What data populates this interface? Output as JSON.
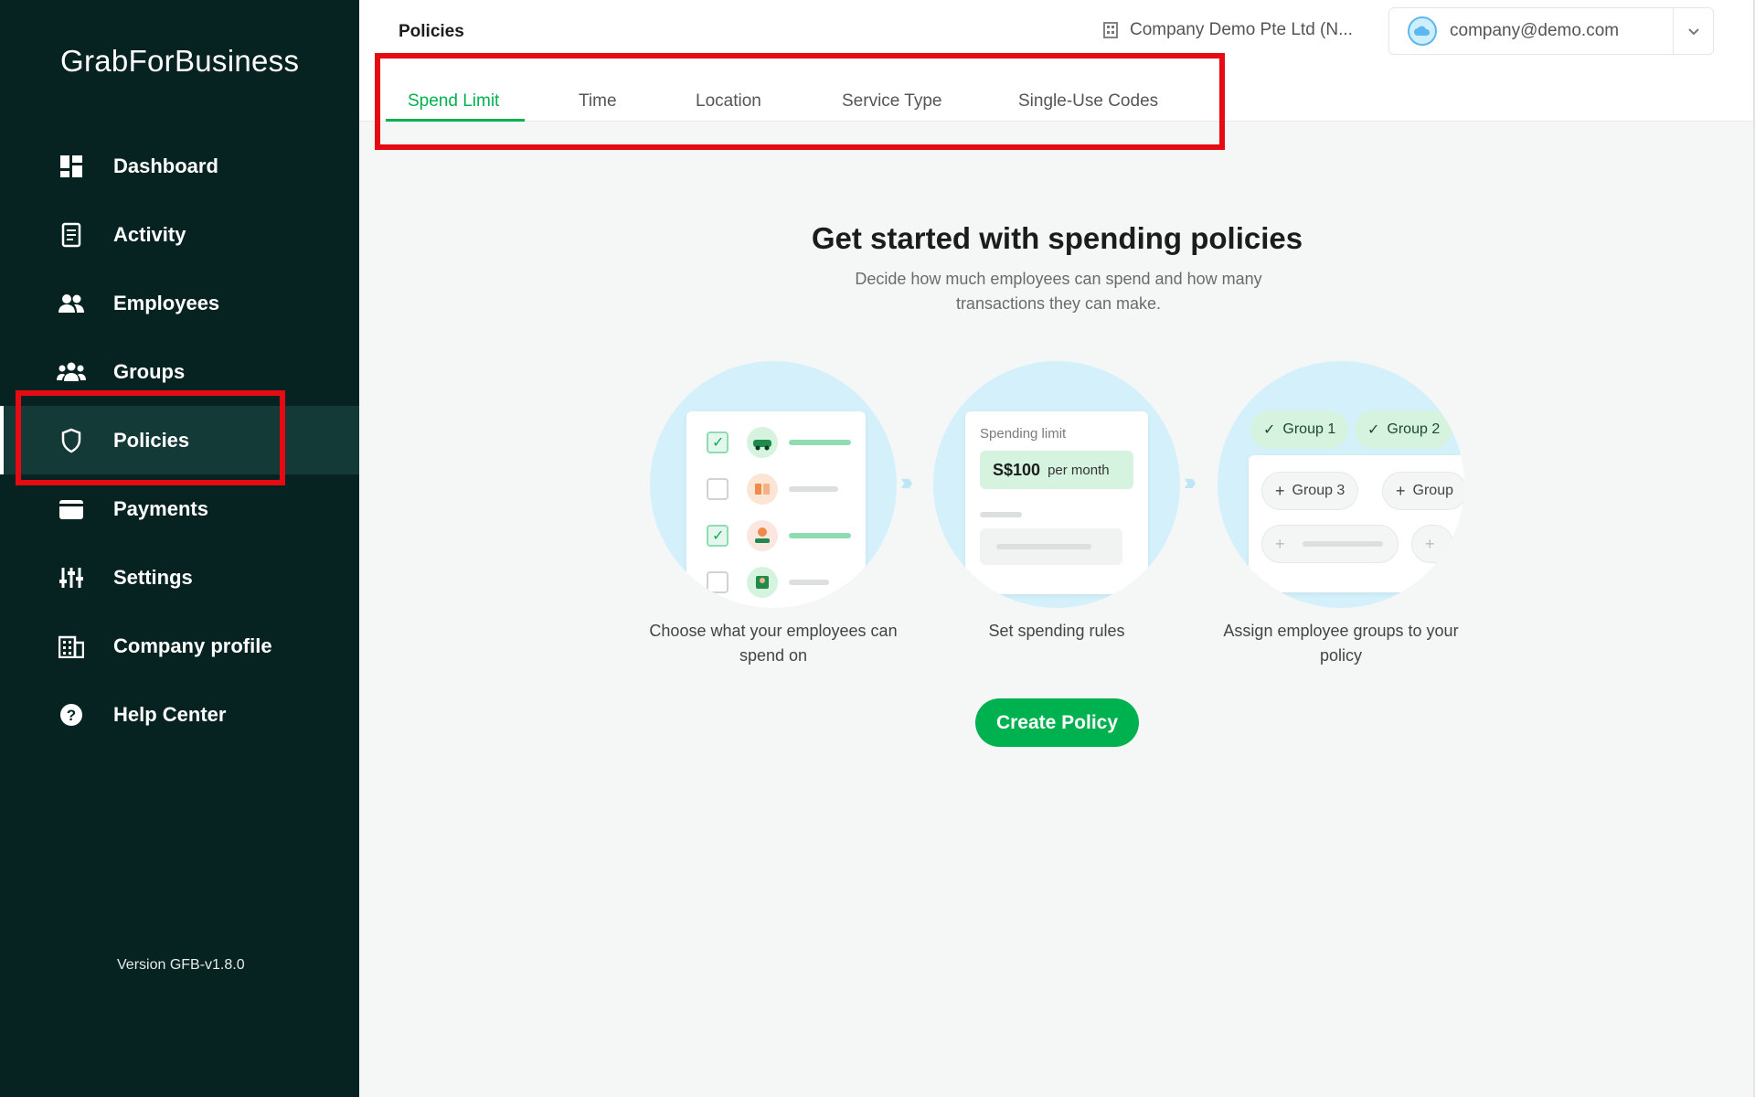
{
  "brand": {
    "logo": "GrabForBusiness",
    "accent": "#00b14f",
    "sidebar_bg": "#062322",
    "highlight": "#e60a12"
  },
  "sidebar": {
    "items": [
      {
        "label": "Dashboard",
        "icon": "dashboard-icon"
      },
      {
        "label": "Activity",
        "icon": "receipt-icon"
      },
      {
        "label": "Employees",
        "icon": "people-icon"
      },
      {
        "label": "Groups",
        "icon": "group-icon"
      },
      {
        "label": "Policies",
        "icon": "shield-icon"
      },
      {
        "label": "Payments",
        "icon": "wallet-icon"
      },
      {
        "label": "Settings",
        "icon": "sliders-icon"
      },
      {
        "label": "Company profile",
        "icon": "building-icon"
      },
      {
        "label": "Help Center",
        "icon": "help-icon"
      }
    ],
    "active": "Policies",
    "version": "Version GFB-v1.8.0"
  },
  "header": {
    "title": "Policies",
    "company": "Company Demo Pte Ltd (N...",
    "email": "company@demo.com"
  },
  "tabs": [
    {
      "label": "Spend Limit"
    },
    {
      "label": "Time"
    },
    {
      "label": "Location"
    },
    {
      "label": "Service Type"
    },
    {
      "label": "Single-Use Codes"
    }
  ],
  "active_tab": "Spend Limit",
  "main": {
    "title": "Get started with spending policies",
    "subtitle": "Decide how much employees can spend and how many transactions they can make.",
    "steps": [
      {
        "label": "Choose what your employees can spend on"
      },
      {
        "label": "Set spending rules"
      },
      {
        "label": "Assign employee groups to your policy"
      }
    ],
    "spending_card": {
      "title": "Spending limit",
      "amount": "S$100",
      "period": "per month"
    },
    "groups": {
      "selected": [
        "Group 1",
        "Group 2"
      ],
      "available": [
        "Group 3",
        "Group"
      ]
    },
    "cta": "Create Policy"
  }
}
